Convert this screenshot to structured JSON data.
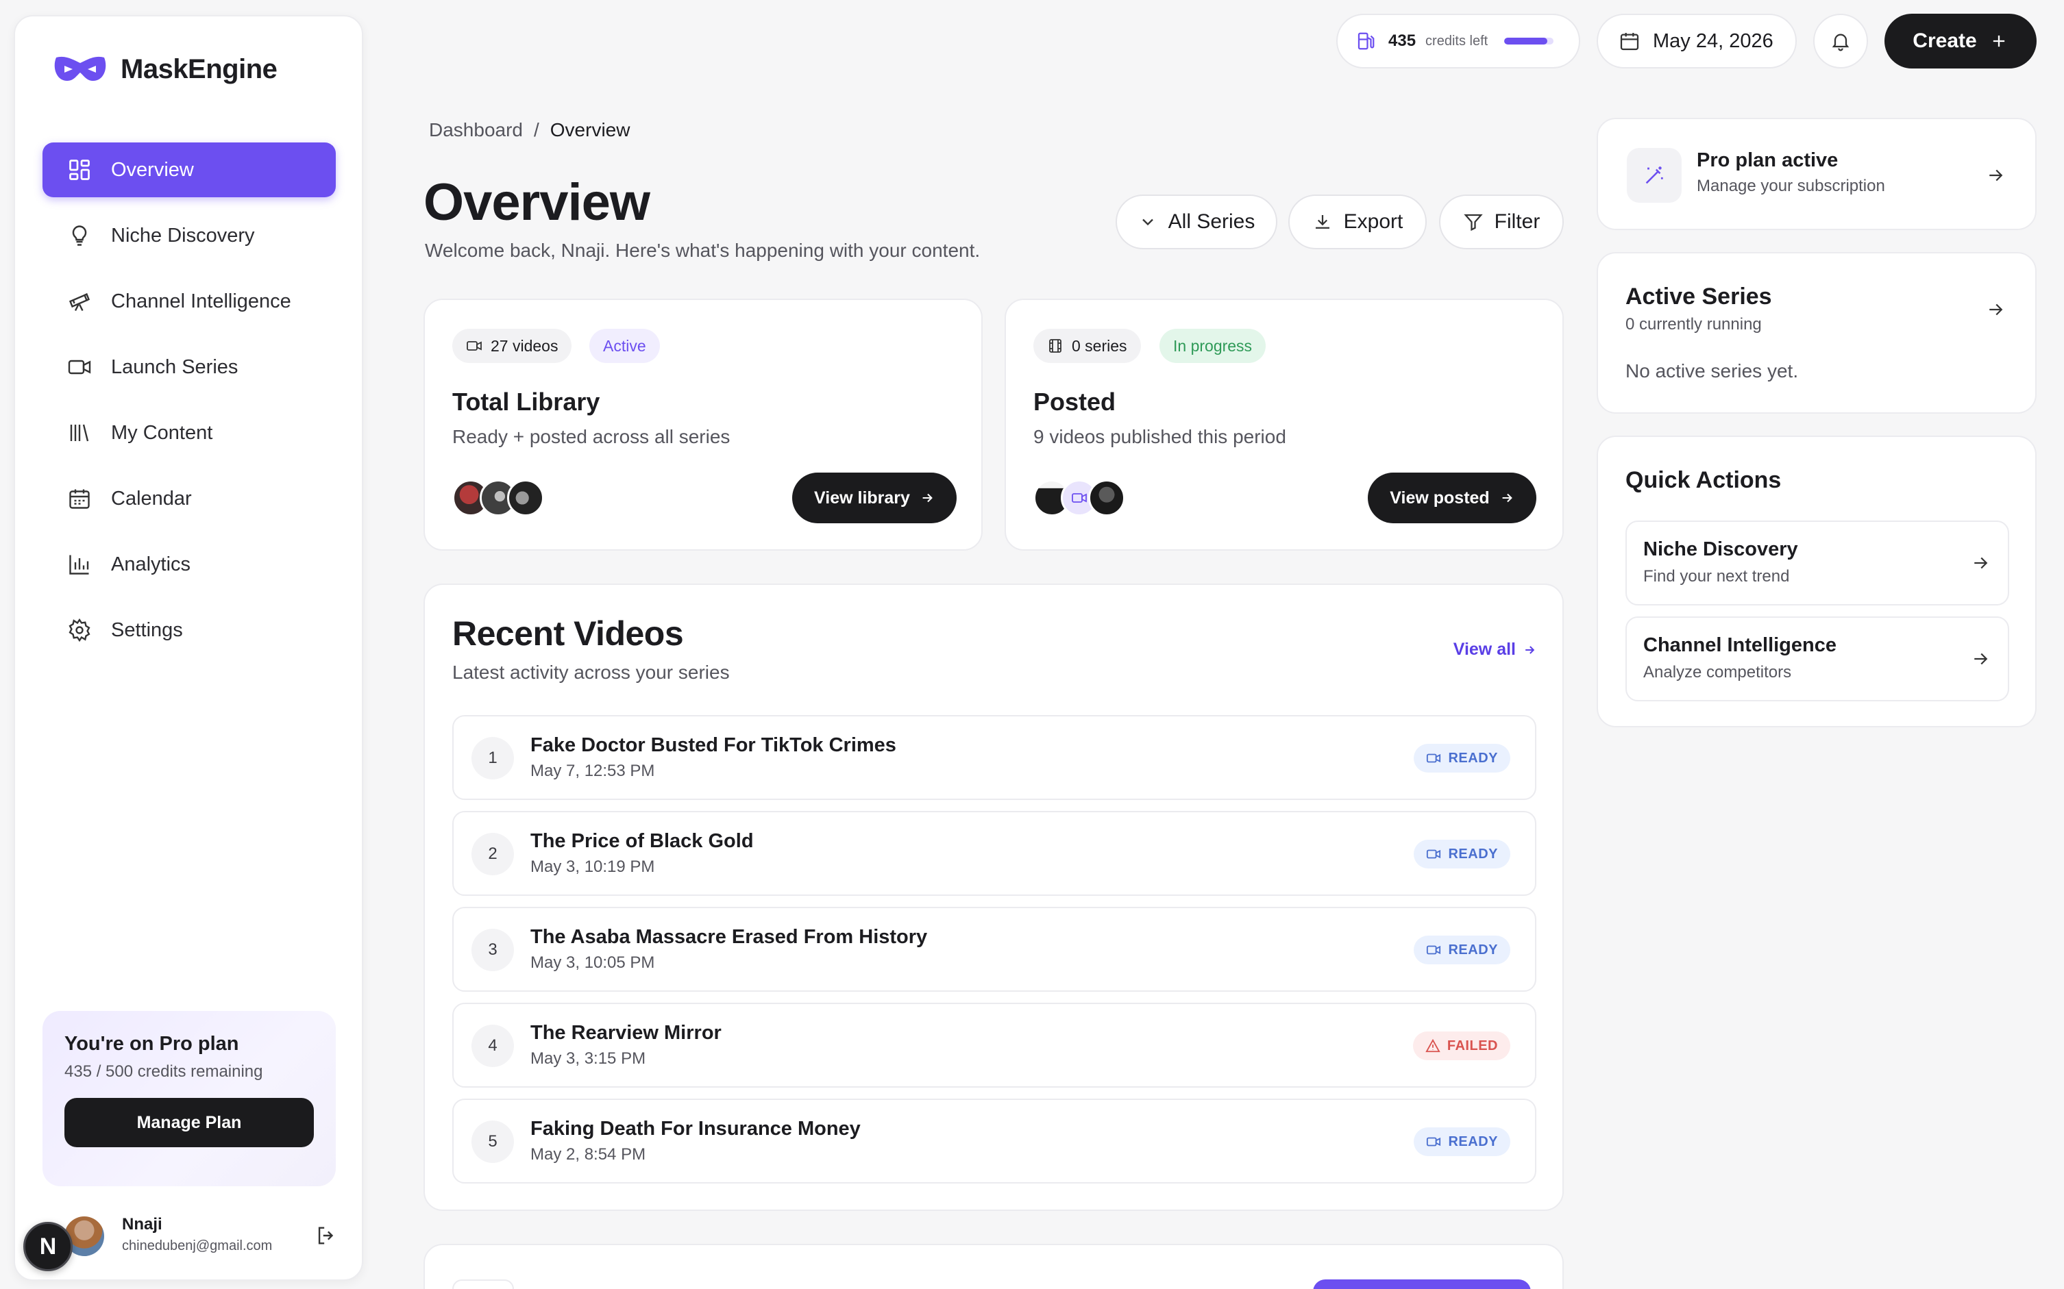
{
  "brand": {
    "name": "MaskEngine",
    "accent": "#6c4ff0"
  },
  "sidebar": {
    "items": [
      {
        "label": "Overview",
        "icon": "dashboard-icon",
        "active": true
      },
      {
        "label": "Niche Discovery",
        "icon": "lightbulb-icon"
      },
      {
        "label": "Channel Intelligence",
        "icon": "telescope-icon"
      },
      {
        "label": "Launch Series",
        "icon": "video-camera-icon"
      },
      {
        "label": "My Content",
        "icon": "library-icon"
      },
      {
        "label": "Calendar",
        "icon": "calendar-icon"
      },
      {
        "label": "Analytics",
        "icon": "bar-chart-icon"
      },
      {
        "label": "Settings",
        "icon": "gear-icon"
      }
    ],
    "plan": {
      "title": "You're on Pro plan",
      "credits": "435 / 500 credits remaining",
      "button": "Manage Plan"
    },
    "user": {
      "name": "Nnaji",
      "email": "chinedubenj@gmail.com",
      "badge": "N"
    }
  },
  "topbar": {
    "credits_value": "435",
    "credits_label": "credits left",
    "credits_fraction": 0.87,
    "date": "May 24, 2026",
    "create_label": "Create"
  },
  "main": {
    "breadcrumb": [
      "Dashboard",
      "Overview"
    ],
    "title": "Overview",
    "subtitle": "Welcome back, Nnaji. Here's what's happening with your content.",
    "toolbar": {
      "series": "All Series",
      "export": "Export",
      "filter": "Filter"
    },
    "library": {
      "count": "27 videos",
      "status": "Active",
      "title": "Total Library",
      "subtitle": "Ready + posted across all series",
      "button": "View library"
    },
    "posted": {
      "count": "0 series",
      "status": "In progress",
      "title": "Posted",
      "subtitle": "9 videos published this period",
      "button": "View posted"
    },
    "recent": {
      "title": "Recent Videos",
      "subtitle": "Latest activity across your series",
      "view_all": "View all",
      "videos": [
        {
          "num": "1",
          "title": "Fake Doctor Busted For TikTok Crimes",
          "date": "May 7, 12:53 PM",
          "status": "READY"
        },
        {
          "num": "2",
          "title": "The Price of Black Gold",
          "date": "May 3, 10:19 PM",
          "status": "READY"
        },
        {
          "num": "3",
          "title": "The Asaba Massacre Erased From History",
          "date": "May 3, 10:05 PM",
          "status": "READY"
        },
        {
          "num": "4",
          "title": "The Rearview Mirror",
          "date": "May 3, 3:15 PM",
          "status": "FAILED"
        },
        {
          "num": "5",
          "title": "Faking Death For Insurance Money",
          "date": "May 2, 8:54 PM",
          "status": "READY"
        }
      ]
    }
  },
  "right": {
    "pro": {
      "title": "Pro plan active",
      "subtitle": "Manage your subscription"
    },
    "active_series": {
      "title": "Active Series",
      "subtitle": "0 currently running",
      "empty": "No active series yet."
    },
    "quick_actions": {
      "title": "Quick Actions",
      "items": [
        {
          "title": "Niche Discovery",
          "subtitle": "Find your next trend"
        },
        {
          "title": "Channel Intelligence",
          "subtitle": "Analyze competitors"
        }
      ]
    }
  }
}
